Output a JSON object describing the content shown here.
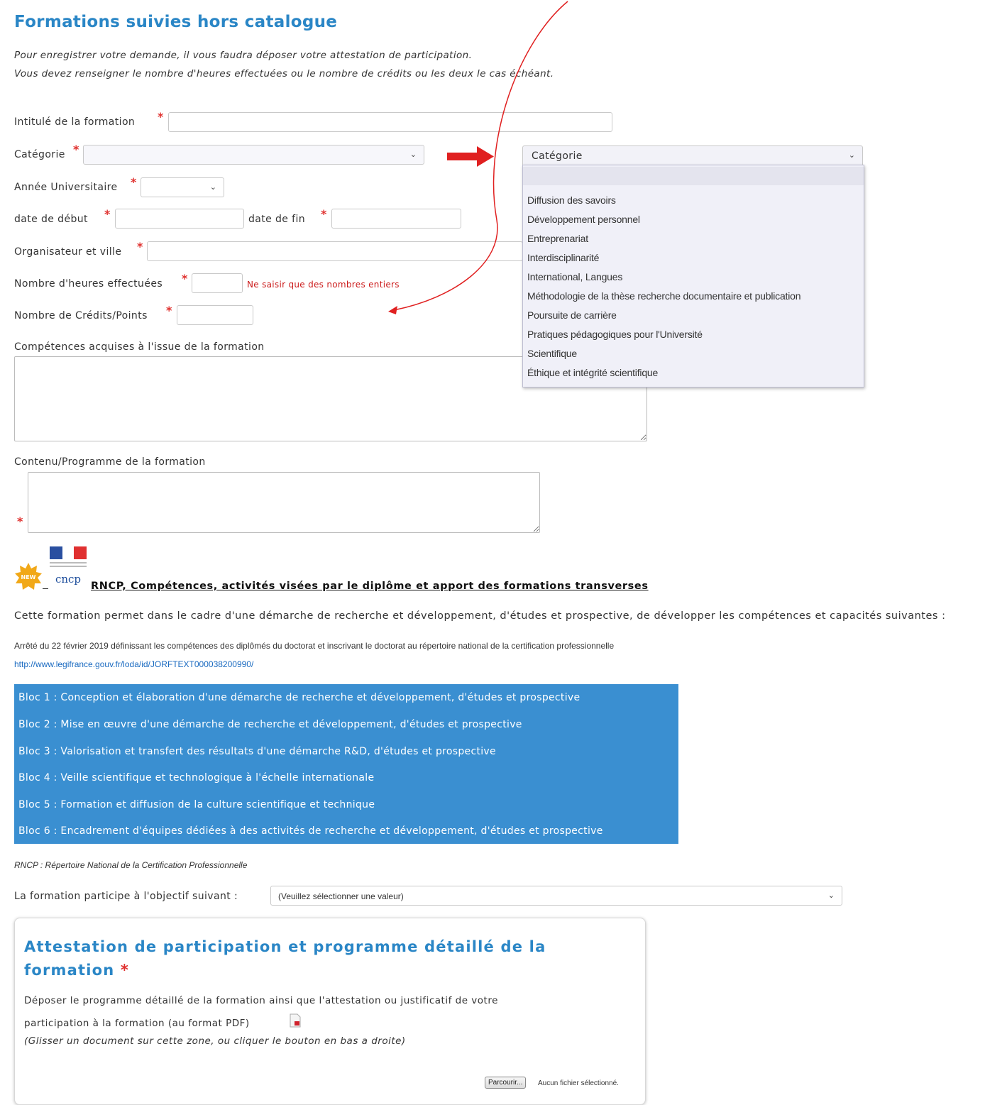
{
  "page": {
    "title": "Formations suivies hors catalogue",
    "intro_line1": "Pour enregistrer votre demande, il vous faudra déposer votre attestation de participation.",
    "intro_line2": "Vous devez renseigner le nombre d'heures effectuées ou le nombre de crédits ou les deux le cas échéant."
  },
  "form": {
    "required_mark": "*",
    "intitule_label": "Intitulé de la formation",
    "categorie_label": "Catégorie",
    "annee_label": "Année Universitaire",
    "date_debut_label": "date de début",
    "date_fin_label": "date de fin",
    "organisateur_label": "Organisateur et ville",
    "heures_label": "Nombre d'heures effectuées",
    "heures_hint": "Ne saisir que des nombres entiers",
    "credits_label": "Nombre de Crédits/Points",
    "competences_label": "Compétences acquises à l'issue de la formation",
    "contenu_label": "Contenu/Programme de la formation"
  },
  "category_dropdown": {
    "selected": "Catégorie",
    "options": [
      "Diffusion des savoirs",
      "Développement personnel",
      "Entreprenariat",
      "Interdisciplinarité",
      "International, Langues",
      "Méthodologie de la thèse recherche documentaire et publication",
      "Poursuite de carrière",
      "Pratiques pédagogiques pour l'Université",
      "Scientifique",
      "Éthique et intégrité scientifique"
    ]
  },
  "rncp": {
    "new_badge": "NEW",
    "logo_text": "cncp",
    "title": "RNCP, Compétences, activités visées par le diplôme et apport des formations transverses",
    "description": "Cette formation permet dans le cadre d'une démarche de recherche et développement, d'études et prospective, de développer les compétences et capacités suivantes :",
    "arrete": "Arrêté du 22 février 2019 définissant les compétences des diplômés du doctorat et inscrivant le doctorat au répertoire national de la certification professionnelle",
    "url": "http://www.legifrance.gouv.fr/loda/id/JORFTEXT000038200990/",
    "blocs": [
      "Bloc 1 : Conception et élaboration d'une démarche de recherche et développement, d'études et prospective",
      "Bloc 2 : Mise en œuvre d'une démarche de recherche et développement, d'études et prospective",
      "Bloc 3 : Valorisation et transfert des résultats d'une démarche R&D, d'études et prospective",
      "Bloc 4 : Veille scientifique et technologique à l'échelle internationale",
      "Bloc 5 : Formation et diffusion de la culture scientifique et technique",
      "Bloc 6 : Encadrement d'équipes dédiées à des activités de recherche et développement, d'études et prospective"
    ],
    "footnote": "RNCP : Répertoire National de la Certification Professionnelle",
    "objectif_label": "La formation participe à l'objectif suivant :",
    "objectif_value": "(Veuillez sélectionner une valeur)"
  },
  "attestation": {
    "title": "Attestation de participation et programme détaillé de la formation",
    "desc_line1": "Déposer le programme détaillé de la formation ainsi que l'attestation ou justificatif de votre",
    "desc_line2": "participation à la formation (au format PDF)",
    "hint": "(Glisser un document sur cette zone, ou cliquer le bouton en bas a droite)",
    "browse_button": "Parcourir...",
    "no_file": "Aucun fichier sélectionné."
  },
  "colors": {
    "accent_blue": "#2a86c6",
    "bloc_blue": "#3a8fd1",
    "required_red": "#e0312f",
    "arrow_red": "#e02020"
  }
}
